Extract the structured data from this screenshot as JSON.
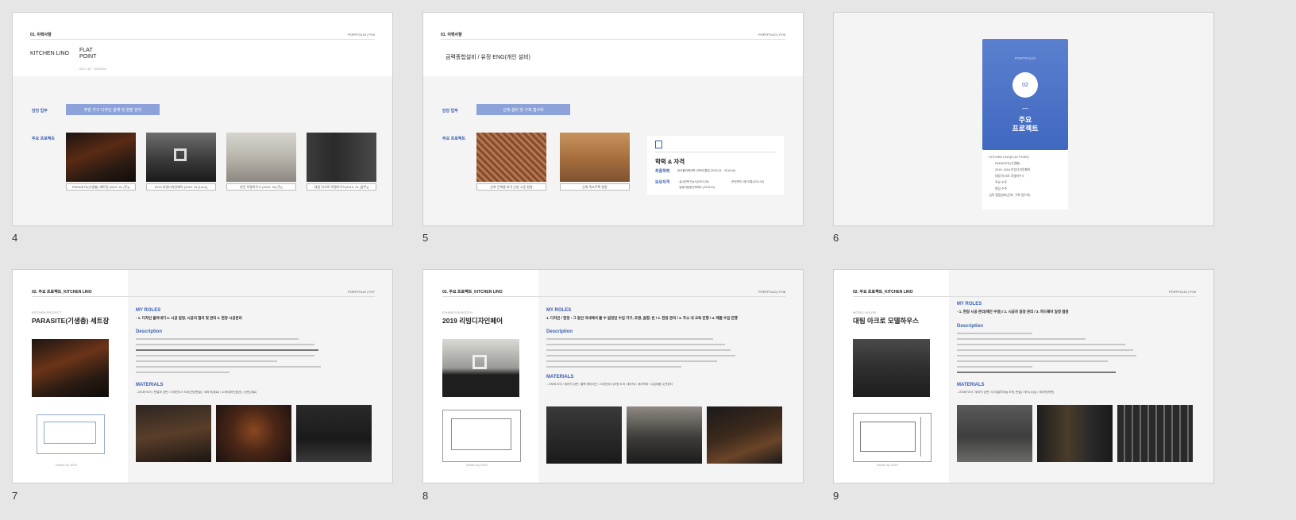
{
  "slides": [
    {
      "number": "4",
      "crumb": "01. 이력사항",
      "page_label": "PORTFOLIO  |  P.04",
      "company": "KITCHEN LINO",
      "company_sub_a": "FLAT",
      "company_sub_b": "POINT",
      "date": "2017.10 ~ 2020.04",
      "duty_label": "담당 업무",
      "duty_pill": "주방 가구 디자인 설계 및 현장 관리",
      "project_label": "주요 프로젝트",
      "captions": [
        "PARASITE(기생충) 세트장 (2019. 01 (주))",
        "2019 리빙디자인페어 (2019. 04 (Lino))",
        "한진 모델하우스 (2019. 08 (주))",
        "대림 아크로 모델하우스(2019. 01 (광주))"
      ]
    },
    {
      "number": "5",
      "crumb": "01. 이력사항",
      "page_label": "PORTFOLIO  |  P.05",
      "company": "금력종합설비 / 유정 ENG(개인 설비)",
      "duty_label": "담당 업무",
      "duty_pill": "신축 설비 및 구축 접수비",
      "project_label": "주요 프로젝트",
      "captions": [
        "신축 건축물 바닥 난방 시공 현장",
        "신축 목조주택 현장"
      ],
      "edu_title": "학력 & 자격",
      "edu_row1_label": "최종학력",
      "edu_row1_text": "한국폴리텍대학 건축과 졸업 (2013.03 ~ 2016.06)",
      "edu_row2_label": "보유자격",
      "edu_row2_text_a": "· 실내건축기능사(2013.05)",
      "edu_row2_text_b": "· 운전면허 1종 보통(2011.02)",
      "edu_row2_text_c": "· 컴퓨터응용건축제도 (2015.04)"
    },
    {
      "number": "6",
      "card_small": "PORTFOLIO",
      "card_circle": "02",
      "card_dash": "—",
      "card_title_a": "주요",
      "card_title_b": "프로젝트",
      "list": [
        "· KITCHEN LINO(FLAT POINT)",
        "PARASITE(기생충)",
        "2019, 2018 리빙디자인페어",
        "대림 아크로 모델하우스",
        "주요 수주",
        "현장 수주",
        "· 금력 종합설비(신축, 구축 접수비)"
      ]
    },
    {
      "number": "7",
      "crumb": "02. 주요 프로젝트_KITCHEN LINO",
      "page_label": "PORTFOLIO  |  P.07",
      "overline": "KITCHEN PROJECT",
      "title": "PARASITE(기생충) 세트장",
      "roles_label": "MY ROLES",
      "roles": "- 1. 디자인 올려내기 2. 시공 일정, 시공의 협의 및 관리 3. 현장 시공관리",
      "desc_label": "Description",
      "materials_label": "MATERIALS",
      "materials": "- 고도화 도어 / 판넬과 상판 / 스테인리스 도어(연상판넬) / 세라믹(세로) / 수세미(하단옵션) / 상판(세로)",
      "footnote": "Drawn by 2019"
    },
    {
      "number": "8",
      "crumb": "02. 주요 프로젝트_KITCHEN LINO",
      "page_label": "PORTFOLIO  |  P.08",
      "overline": "EXHIBITION BOOTH",
      "title": "2019 리빙디자인페어",
      "roles_label": "MY ROLES",
      "roles": "1. 디자인 / 현장 : 그 동안 국내에서 볼 수 없었던 수입 가구, 조명, 음향, 빈 / 2. 현장 관리 / 3. 주소 내 교육 진행 / 4. 제품 수입 진행",
      "desc_label": "Description",
      "materials_label": "MATERIALS",
      "materials": "- 고도화 도어 / 세라믹 상판 / 블랙 헤어라인 / 스테인리스(조명 도어, 세라믹) / 세라믹바 / 수입제품 수전장치",
      "footnote": "Drawn by 2019"
    },
    {
      "number": "9",
      "crumb": "02. 주요 프로젝트_KITCHEN LINO",
      "page_label": "PORTFOLIO  |  P.09",
      "overline": "MODEL HOUSE",
      "title": "대림 아크로 모델하우스",
      "roles_label": "MY ROLES",
      "roles": "- 1. 현장 시공 관리(제안 수정) / 2. 시공자 일정 관리 / 3. 하드웨어 일정 점검",
      "desc_label": "Description",
      "materials_label": "MATERIALS",
      "materials": "- 고도화 도어 / 세라믹 상판 / 다리(알루미늄 조명, 판넬) / 후드(수입) / 세라믹(벽면)",
      "footnote": "Drawn by 2019"
    }
  ],
  "colors": {
    "accent_blue": "#3a5fb0",
    "pill_blue": "#8da2d8",
    "card_blue": "#4a72c8"
  }
}
